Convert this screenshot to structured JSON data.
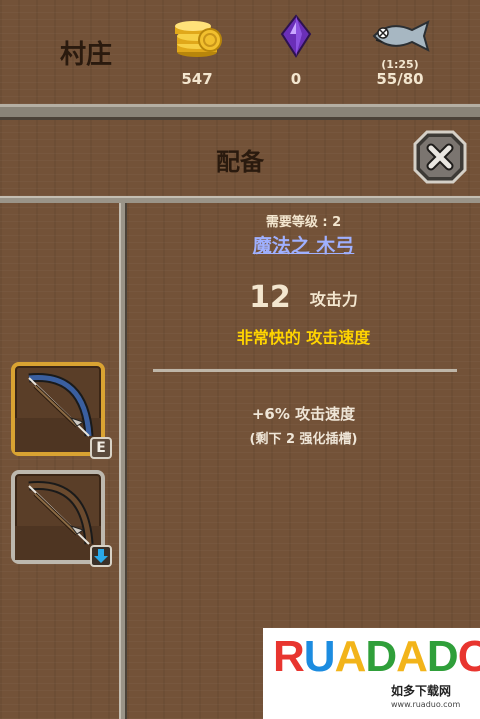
{
  "header": {
    "location": "村庄",
    "resources": {
      "gold": {
        "icon": "gold-coins-icon",
        "value": "547"
      },
      "gem": {
        "icon": "purple-crystal-icon",
        "value": "0"
      },
      "fish": {
        "icon": "fish-icon",
        "timer": "(1:25)",
        "value": "55/80"
      }
    }
  },
  "panel": {
    "title": "配备",
    "close_icon": "close-icon"
  },
  "slots": [
    {
      "name": "bow-equipped",
      "icon": "bow-icon",
      "badge": "E",
      "state": "equipped"
    },
    {
      "name": "bow-other",
      "icon": "bow-icon",
      "badge_icon": "arrow-down-icon",
      "state": "inventory"
    }
  ],
  "item": {
    "requirement": "需要等级 : 2",
    "name": "魔法之 木弓",
    "attack_value": "12",
    "attack_label": "攻击力",
    "speed": "非常快的 攻击速度",
    "bonus": "+6% 攻击速度",
    "slots_remaining": "(剩下 2 强化插槽)"
  },
  "colors": {
    "wood": "#735238",
    "gold_border": "#d9a332",
    "item_name": "#9fb0ff",
    "speed_text": "#ffd400"
  },
  "watermark": {
    "logo_letters": [
      "R",
      "U",
      "A",
      "D",
      "A",
      "D",
      "O"
    ],
    "subtitle": "如多下载网",
    "url": "www.ruaduo.com"
  }
}
